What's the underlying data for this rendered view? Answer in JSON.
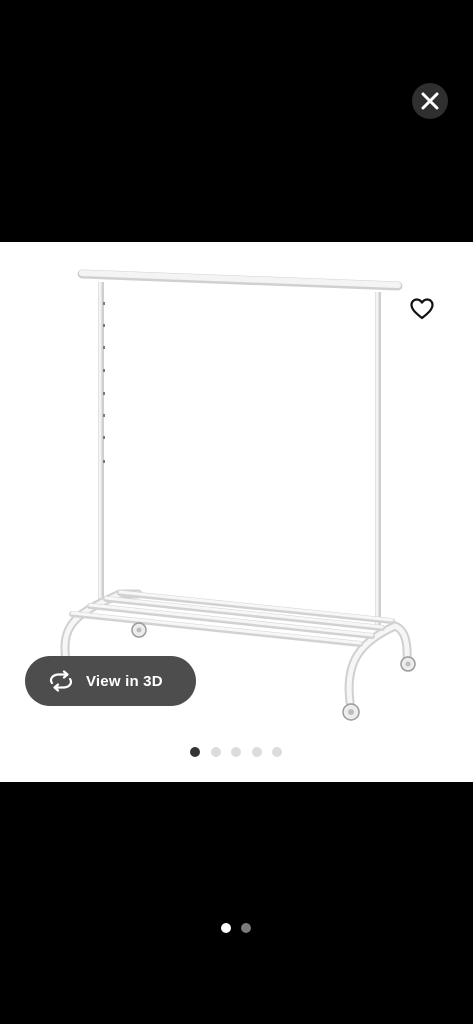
{
  "close": {
    "icon": "close-icon"
  },
  "product": {
    "image_alt": "clothes-rack-product-image",
    "favorite_icon": "heart-outline-icon"
  },
  "view3d": {
    "label": "View in 3D",
    "icon": "rotate-3d-icon"
  },
  "carousel": {
    "total": 5,
    "active_index": 0
  },
  "pages": {
    "total": 2,
    "active_index": 0
  },
  "colors": {
    "background": "#000000",
    "panel": "#ffffff",
    "button_bg": "#4d4d4d",
    "dot_active": "#333333",
    "dot_inactive": "#dcdcdc"
  }
}
